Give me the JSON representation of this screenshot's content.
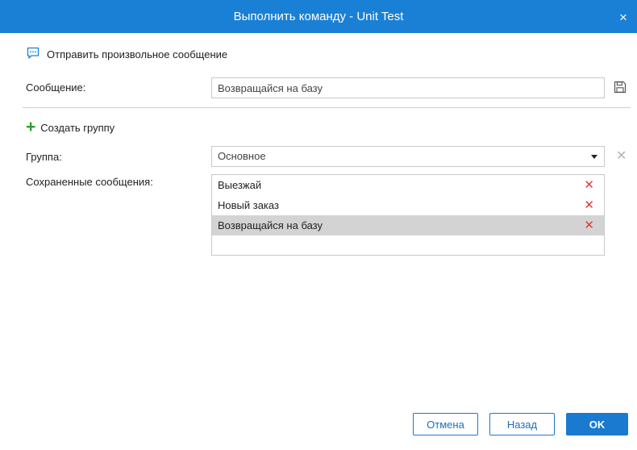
{
  "window": {
    "title": "Выполнить команду - Unit Test",
    "close_glyph": "×"
  },
  "send_section": {
    "label": "Отправить произвольное сообщение",
    "icon": "chat-bubble-icon"
  },
  "message": {
    "label": "Сообщение:",
    "value": "Возвращайся на базу",
    "save_icon": "floppy-disk-icon"
  },
  "create_group": {
    "label": "Создать группу",
    "glyph": "+"
  },
  "group": {
    "label": "Группа:",
    "selected": "Основное",
    "clear_glyph": "✕"
  },
  "saved_messages": {
    "label": "Сохраненные сообщения:",
    "delete_glyph": "✕",
    "items": [
      {
        "text": "Выезжай"
      },
      {
        "text": "Новый заказ"
      },
      {
        "text": "Возвращайся на базу"
      }
    ],
    "selected_index": 2
  },
  "buttons": {
    "cancel": "Отмена",
    "back": "Назад",
    "ok": "OK"
  },
  "colors": {
    "titlebar": "#1a80d6",
    "accent": "#1a7ad0",
    "add": "#2e9e2e",
    "delete": "#e53935",
    "selected_row": "#d3d3d3"
  }
}
